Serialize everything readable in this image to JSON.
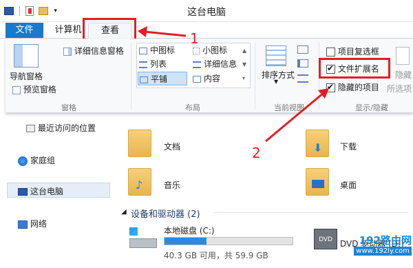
{
  "window": {
    "title": "这台电脑"
  },
  "tabs": {
    "file": "文件",
    "computer": "计算机",
    "view": "查看"
  },
  "ribbon": {
    "pane": {
      "nav_pane": "导航窗格",
      "preview_pane": "预览窗格",
      "details_pane": "详细信息窗格",
      "group": "窗格"
    },
    "layout": {
      "items": [
        "中图标",
        "小图标",
        "列表",
        "详细信息",
        "平铺",
        "内容"
      ],
      "group": "布局"
    },
    "current_view": {
      "sort": "排序方式",
      "group": "当前视图"
    },
    "show_hide": {
      "item_checkbox": "项目复选框",
      "file_ext": "文件扩展名",
      "hidden_items": "隐藏的项目",
      "hide": "隐藏",
      "selected": "所选项",
      "group": "显示/隐藏"
    }
  },
  "annotations": {
    "one": "1",
    "two": "2"
  },
  "nav": {
    "recent": "最近访问的位置",
    "homegroup": "家庭组",
    "this_pc": "这台电脑",
    "network": "网络"
  },
  "folders": {
    "docs": "文档",
    "downloads": "下载",
    "music": "音乐",
    "desktop": "桌面"
  },
  "devices": {
    "title": "设备和驱动器 (2)",
    "local_disk": "本地磁盘 (C:)",
    "local_disk_space": "40.3 GB 可用，共 59.9 GB",
    "used_fraction": 0.33,
    "dvd": "DVD 驱动器 (D:)"
  },
  "watermark": {
    "brand": "192路由网",
    "site": "www.192ly.com"
  }
}
